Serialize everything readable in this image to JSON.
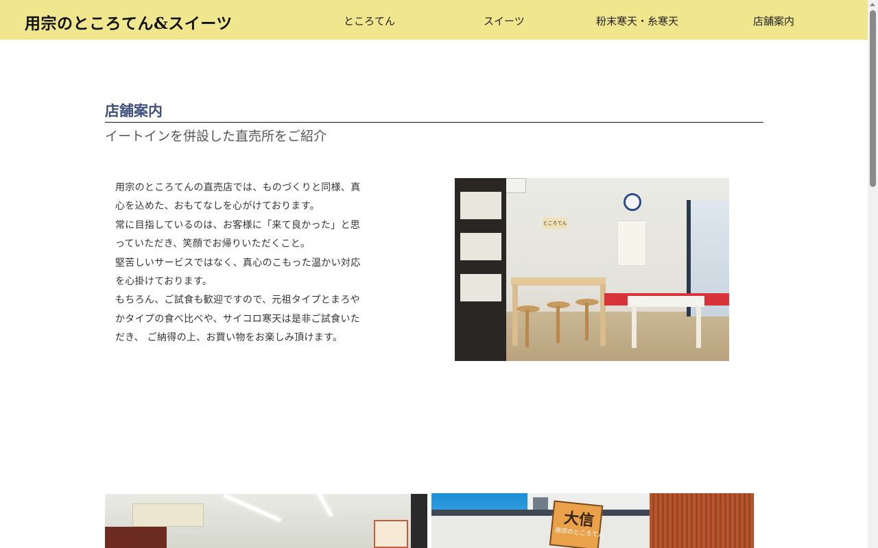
{
  "header": {
    "site_title": "用宗のところてん&スイーツ",
    "nav": [
      "ところてん",
      "スイーツ",
      "粉末寒天・糸寒天",
      "店舗案内"
    ],
    "background_color": "#efe68e"
  },
  "section": {
    "heading": "店舗案内",
    "subheading": "イートインを併設した直売所をご紹介",
    "heading_color": "#3f4f80"
  },
  "intro": {
    "paragraphs": [
      "用宗のところてんの直売店では、ものづくりと同様、真\n心を込めた、おもてなしを心がけております。",
      "常に目指しているのは、お客様に「来て良かった」と思\nっていただき、笑顔でお帰りいただくこと。",
      "堅苦しいサービスではなく、真心のこもった温かい対応\nを心掛けております。",
      "もちろん、ご試食も歓迎ですので、元祖タイプとまろや\nかタイプの食べ比べや、サイコロ寒天は是非ご試食いた\nだき、 ご納得の上、お買い物をお楽しみ頂けます。"
    ]
  },
  "photos": {
    "eat_in_sign": "ところてん",
    "store_sign": "大信",
    "store_sign_sub": "用宗のところてん"
  }
}
